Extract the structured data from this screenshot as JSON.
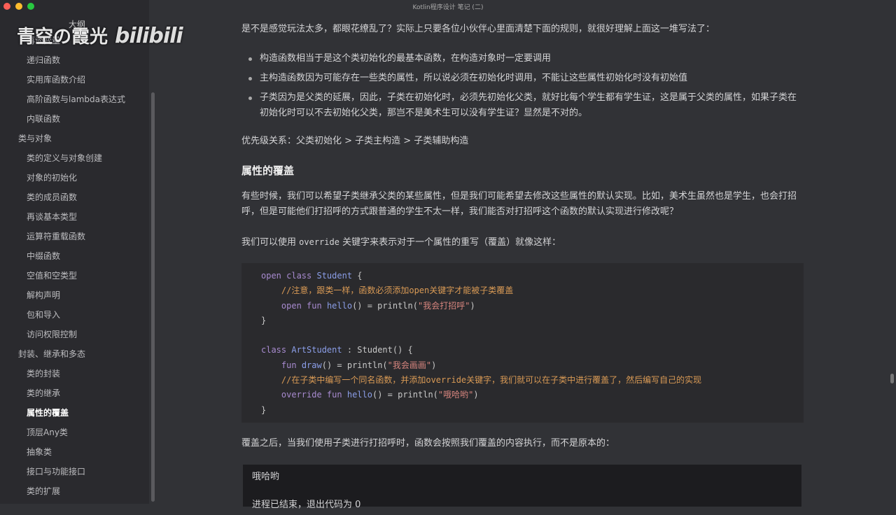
{
  "window": {
    "title": "Kotlin程序设计 笔记 (二)"
  },
  "watermark": {
    "text": "青空の霞光",
    "brand": "bilibili"
  },
  "sidebar": {
    "title": "大纲",
    "items": [
      {
        "label": "再谈变量",
        "level": 2
      },
      {
        "label": "递归函数",
        "level": 2
      },
      {
        "label": "实用库函数介绍",
        "level": 2
      },
      {
        "label": "高阶函数与lambda表达式",
        "level": 2
      },
      {
        "label": "内联函数",
        "level": 2
      },
      {
        "label": "类与对象",
        "level": 1
      },
      {
        "label": "类的定义与对象创建",
        "level": 2
      },
      {
        "label": "对象的初始化",
        "level": 2
      },
      {
        "label": "类的成员函数",
        "level": 2
      },
      {
        "label": "再谈基本类型",
        "level": 2
      },
      {
        "label": "运算符重载函数",
        "level": 2
      },
      {
        "label": "中缀函数",
        "level": 2
      },
      {
        "label": "空值和空类型",
        "level": 2
      },
      {
        "label": "解构声明",
        "level": 2
      },
      {
        "label": "包和导入",
        "level": 2
      },
      {
        "label": "访问权限控制",
        "level": 2
      },
      {
        "label": "封装、继承和多态",
        "level": 1
      },
      {
        "label": "类的封装",
        "level": 2
      },
      {
        "label": "类的继承",
        "level": 2
      },
      {
        "label": "属性的覆盖",
        "level": 2,
        "active": true
      },
      {
        "label": "顶层Any类",
        "level": 2
      },
      {
        "label": "抽象类",
        "level": 2
      },
      {
        "label": "接口与功能接口",
        "level": 2
      },
      {
        "label": "类的扩展",
        "level": 2
      }
    ]
  },
  "content": {
    "intro": "是不是感觉玩法太多，都眼花缭乱了？实际上只要各位小伙伴心里面清楚下面的规则，就很好理解上面这一堆写法了：",
    "bullets": [
      "构造函数相当于是这个类初始化的最基本函数，在构造对象时一定要调用",
      "主构造函数因为可能存在一些类的属性，所以说必须在初始化时调用，不能让这些属性初始化时没有初始值",
      "子类因为是父类的延展，因此，子类在初始化时，必须先初始化父类，就好比每个学生都有学生证，这是属于父类的属性，如果子类在初始化时可以不去初始化父类，那岂不是美术生可以没有学生证？显然是不对的。"
    ],
    "priority": "优先级关系：父类初始化 > 子类主构造 > 子类辅助构造",
    "heading": "属性的覆盖",
    "para1": "有些时候，我们可以希望子类继承父类的某些属性，但是我们可能希望去修改这些属性的默认实现。比如，美术生虽然也是学生，也会打招呼，但是可能他们打招呼的方式跟普通的学生不太一样，我们能否对打招呼这个函数的默认实现进行修改呢？",
    "para2_pre": "我们可以使用 ",
    "para2_code": "override",
    "para2_post": " 关键字来表示对于一个属性的重写（覆盖）就像这样：",
    "code": {
      "c1": "//注意，跟类一样，函数必须添加open关键字才能被子类覆盖",
      "s1": "\"我会打招呼\"",
      "s2": "\"我会画画\"",
      "c2": "//在子类中编写一个同名函数，并添加override关键字，我们就可以在子类中进行覆盖了，然后编写自己的实现",
      "s3": "\"哦哈哟\""
    },
    "para3": "覆盖之后，当我们使用子类进行打招呼时，函数会按照我们覆盖的内容执行，而不是原本的：",
    "output": [
      "哦哈哟",
      "进程已结束，退出代码为 0"
    ]
  }
}
